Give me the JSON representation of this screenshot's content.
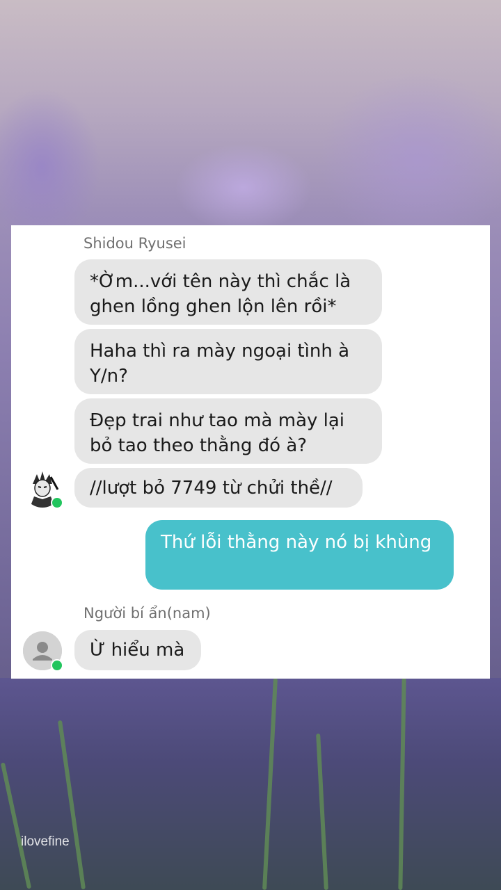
{
  "conversation": {
    "groups": [
      {
        "sender": "Shidou Ryusei",
        "messages": [
          "*Ờm...với tên này thì chắc là ghen lồng ghen lộn lên rồi*",
          "Haha thì ra mày ngoại tình à Y/n?",
          "Đẹp trai như tao mà mày lại bỏ tao theo thằng đó à?",
          "//lượt bỏ 7749 từ chửi thề//"
        ]
      }
    ],
    "outgoing": [
      "Thứ lỗi thằng này nó bị khùng"
    ],
    "group2": {
      "sender": "Người bí ẩn(nam)",
      "messages": [
        "Ừ hiểu mà"
      ]
    }
  },
  "watermark": "ilovefine",
  "colors": {
    "incoming_bubble": "#e6e6e6",
    "outgoing_bubble": "#48c1cb",
    "online_dot": "#22c55e"
  },
  "icons": {
    "avatar1": "manga-character-avatar",
    "avatar2": "default-person-icon"
  }
}
